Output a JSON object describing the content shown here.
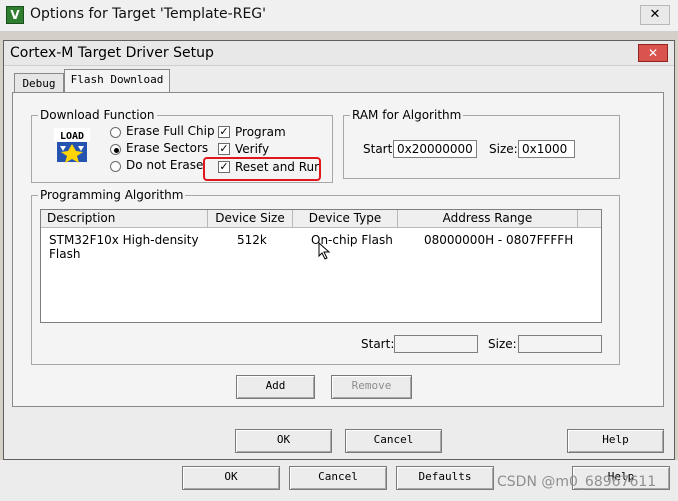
{
  "outer_window": {
    "title": "Options for Target 'Template-REG'",
    "close_label": "✕",
    "bottom_buttons": [
      "OK",
      "Cancel",
      "Defaults",
      "Help"
    ]
  },
  "dialog": {
    "title": "Cortex-M Target Driver Setup",
    "close_label": "✕",
    "tabs": [
      "Debug",
      "Flash Download"
    ],
    "download_function": {
      "label": "Download Function",
      "load_icon_text": "LOAD",
      "radios": [
        {
          "label": "Erase Full Chip",
          "checked": false
        },
        {
          "label": "Erase Sectors",
          "checked": true
        },
        {
          "label": "Do not Erase",
          "checked": false
        }
      ],
      "checks": [
        {
          "label": "Program",
          "checked": true
        },
        {
          "label": "Verify",
          "checked": true
        },
        {
          "label": "Reset and Run",
          "checked": true
        }
      ]
    },
    "ram": {
      "label": "RAM for Algorithm",
      "start_label": "Start:",
      "start_value": "0x20000000",
      "size_label": "Size:",
      "size_value": "0x1000"
    },
    "programming_algorithm": {
      "label": "Programming Algorithm",
      "columns": [
        "Description",
        "Device Size",
        "Device Type",
        "Address Range"
      ],
      "rows": [
        [
          "STM32F10x High-density Flash",
          "512k",
          "On-chip Flash",
          "08000000H - 0807FFFFH"
        ]
      ],
      "start_label": "Start:",
      "size_label": "Size:",
      "add_label": "Add",
      "remove_label": "Remove"
    },
    "buttons": {
      "ok": "OK",
      "cancel": "Cancel",
      "help": "Help"
    }
  },
  "watermark": "CSDN @m0_68967611"
}
